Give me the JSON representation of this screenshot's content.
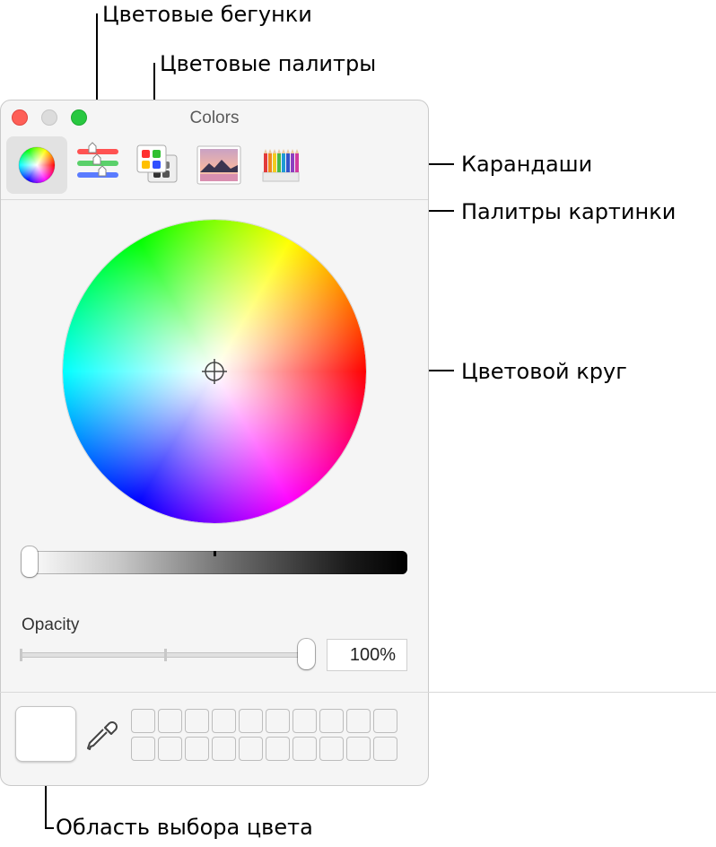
{
  "window": {
    "title": "Colors",
    "traffic_lights": {
      "close": "#fe5f57",
      "minimize": "#dcdcdc",
      "zoom": "#28c840"
    }
  },
  "toolbar": {
    "tabs": [
      {
        "id": "color-wheel",
        "icon": "color-wheel-icon",
        "active": true
      },
      {
        "id": "color-sliders",
        "icon": "sliders-icon",
        "active": false
      },
      {
        "id": "color-palettes",
        "icon": "palettes-icon",
        "active": false
      },
      {
        "id": "image-palettes",
        "icon": "image-icon",
        "active": false
      },
      {
        "id": "pencils",
        "icon": "pencils-icon",
        "active": false
      }
    ]
  },
  "brightness": {
    "value": 1.0
  },
  "opacity": {
    "label": "Opacity",
    "value": "100%"
  },
  "swatches": {
    "selected_color": "#ffffff",
    "empty_slots": 20
  },
  "callouts": {
    "sliders": "Цветовые бегунки",
    "palettes": "Цветовые палитры",
    "pencils": "Карандаши",
    "image_palettes": "Палитры картинки",
    "color_wheel": "Цветовой круг",
    "color_well": "Область выбора цвета"
  }
}
